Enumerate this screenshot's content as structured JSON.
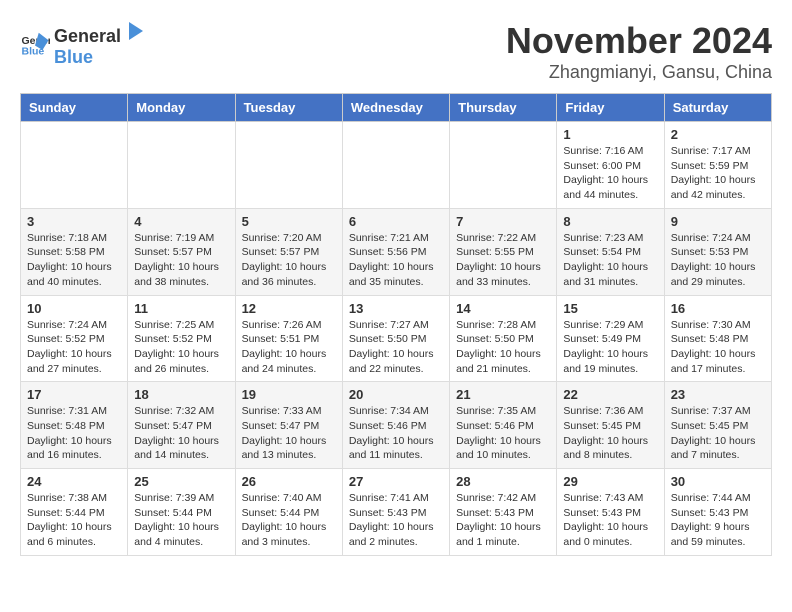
{
  "logo": {
    "general": "General",
    "blue": "Blue"
  },
  "title": "November 2024",
  "location": "Zhangmianyi, Gansu, China",
  "days_of_week": [
    "Sunday",
    "Monday",
    "Tuesday",
    "Wednesday",
    "Thursday",
    "Friday",
    "Saturday"
  ],
  "weeks": [
    [
      {
        "day": "",
        "info": ""
      },
      {
        "day": "",
        "info": ""
      },
      {
        "day": "",
        "info": ""
      },
      {
        "day": "",
        "info": ""
      },
      {
        "day": "",
        "info": ""
      },
      {
        "day": "1",
        "info": "Sunrise: 7:16 AM\nSunset: 6:00 PM\nDaylight: 10 hours and 44 minutes."
      },
      {
        "day": "2",
        "info": "Sunrise: 7:17 AM\nSunset: 5:59 PM\nDaylight: 10 hours and 42 minutes."
      }
    ],
    [
      {
        "day": "3",
        "info": "Sunrise: 7:18 AM\nSunset: 5:58 PM\nDaylight: 10 hours and 40 minutes."
      },
      {
        "day": "4",
        "info": "Sunrise: 7:19 AM\nSunset: 5:57 PM\nDaylight: 10 hours and 38 minutes."
      },
      {
        "day": "5",
        "info": "Sunrise: 7:20 AM\nSunset: 5:57 PM\nDaylight: 10 hours and 36 minutes."
      },
      {
        "day": "6",
        "info": "Sunrise: 7:21 AM\nSunset: 5:56 PM\nDaylight: 10 hours and 35 minutes."
      },
      {
        "day": "7",
        "info": "Sunrise: 7:22 AM\nSunset: 5:55 PM\nDaylight: 10 hours and 33 minutes."
      },
      {
        "day": "8",
        "info": "Sunrise: 7:23 AM\nSunset: 5:54 PM\nDaylight: 10 hours and 31 minutes."
      },
      {
        "day": "9",
        "info": "Sunrise: 7:24 AM\nSunset: 5:53 PM\nDaylight: 10 hours and 29 minutes."
      }
    ],
    [
      {
        "day": "10",
        "info": "Sunrise: 7:24 AM\nSunset: 5:52 PM\nDaylight: 10 hours and 27 minutes."
      },
      {
        "day": "11",
        "info": "Sunrise: 7:25 AM\nSunset: 5:52 PM\nDaylight: 10 hours and 26 minutes."
      },
      {
        "day": "12",
        "info": "Sunrise: 7:26 AM\nSunset: 5:51 PM\nDaylight: 10 hours and 24 minutes."
      },
      {
        "day": "13",
        "info": "Sunrise: 7:27 AM\nSunset: 5:50 PM\nDaylight: 10 hours and 22 minutes."
      },
      {
        "day": "14",
        "info": "Sunrise: 7:28 AM\nSunset: 5:50 PM\nDaylight: 10 hours and 21 minutes."
      },
      {
        "day": "15",
        "info": "Sunrise: 7:29 AM\nSunset: 5:49 PM\nDaylight: 10 hours and 19 minutes."
      },
      {
        "day": "16",
        "info": "Sunrise: 7:30 AM\nSunset: 5:48 PM\nDaylight: 10 hours and 17 minutes."
      }
    ],
    [
      {
        "day": "17",
        "info": "Sunrise: 7:31 AM\nSunset: 5:48 PM\nDaylight: 10 hours and 16 minutes."
      },
      {
        "day": "18",
        "info": "Sunrise: 7:32 AM\nSunset: 5:47 PM\nDaylight: 10 hours and 14 minutes."
      },
      {
        "day": "19",
        "info": "Sunrise: 7:33 AM\nSunset: 5:47 PM\nDaylight: 10 hours and 13 minutes."
      },
      {
        "day": "20",
        "info": "Sunrise: 7:34 AM\nSunset: 5:46 PM\nDaylight: 10 hours and 11 minutes."
      },
      {
        "day": "21",
        "info": "Sunrise: 7:35 AM\nSunset: 5:46 PM\nDaylight: 10 hours and 10 minutes."
      },
      {
        "day": "22",
        "info": "Sunrise: 7:36 AM\nSunset: 5:45 PM\nDaylight: 10 hours and 8 minutes."
      },
      {
        "day": "23",
        "info": "Sunrise: 7:37 AM\nSunset: 5:45 PM\nDaylight: 10 hours and 7 minutes."
      }
    ],
    [
      {
        "day": "24",
        "info": "Sunrise: 7:38 AM\nSunset: 5:44 PM\nDaylight: 10 hours and 6 minutes."
      },
      {
        "day": "25",
        "info": "Sunrise: 7:39 AM\nSunset: 5:44 PM\nDaylight: 10 hours and 4 minutes."
      },
      {
        "day": "26",
        "info": "Sunrise: 7:40 AM\nSunset: 5:44 PM\nDaylight: 10 hours and 3 minutes."
      },
      {
        "day": "27",
        "info": "Sunrise: 7:41 AM\nSunset: 5:43 PM\nDaylight: 10 hours and 2 minutes."
      },
      {
        "day": "28",
        "info": "Sunrise: 7:42 AM\nSunset: 5:43 PM\nDaylight: 10 hours and 1 minute."
      },
      {
        "day": "29",
        "info": "Sunrise: 7:43 AM\nSunset: 5:43 PM\nDaylight: 10 hours and 0 minutes."
      },
      {
        "day": "30",
        "info": "Sunrise: 7:44 AM\nSunset: 5:43 PM\nDaylight: 9 hours and 59 minutes."
      }
    ]
  ]
}
